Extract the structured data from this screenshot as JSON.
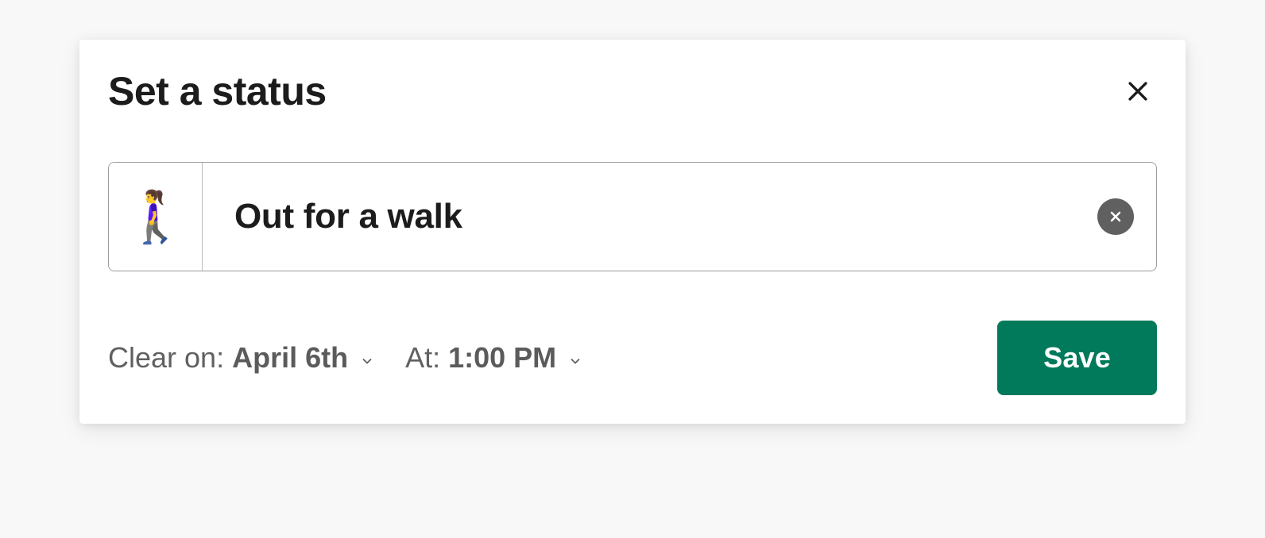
{
  "modal": {
    "title": "Set a status",
    "status": {
      "emoji": "🚶‍♀️",
      "text": "Out for a walk"
    },
    "schedule": {
      "clear_on_label": "Clear on:",
      "clear_on_value": "April 6th",
      "at_label": "At:",
      "at_value": "1:00 PM"
    },
    "save_label": "Save"
  }
}
